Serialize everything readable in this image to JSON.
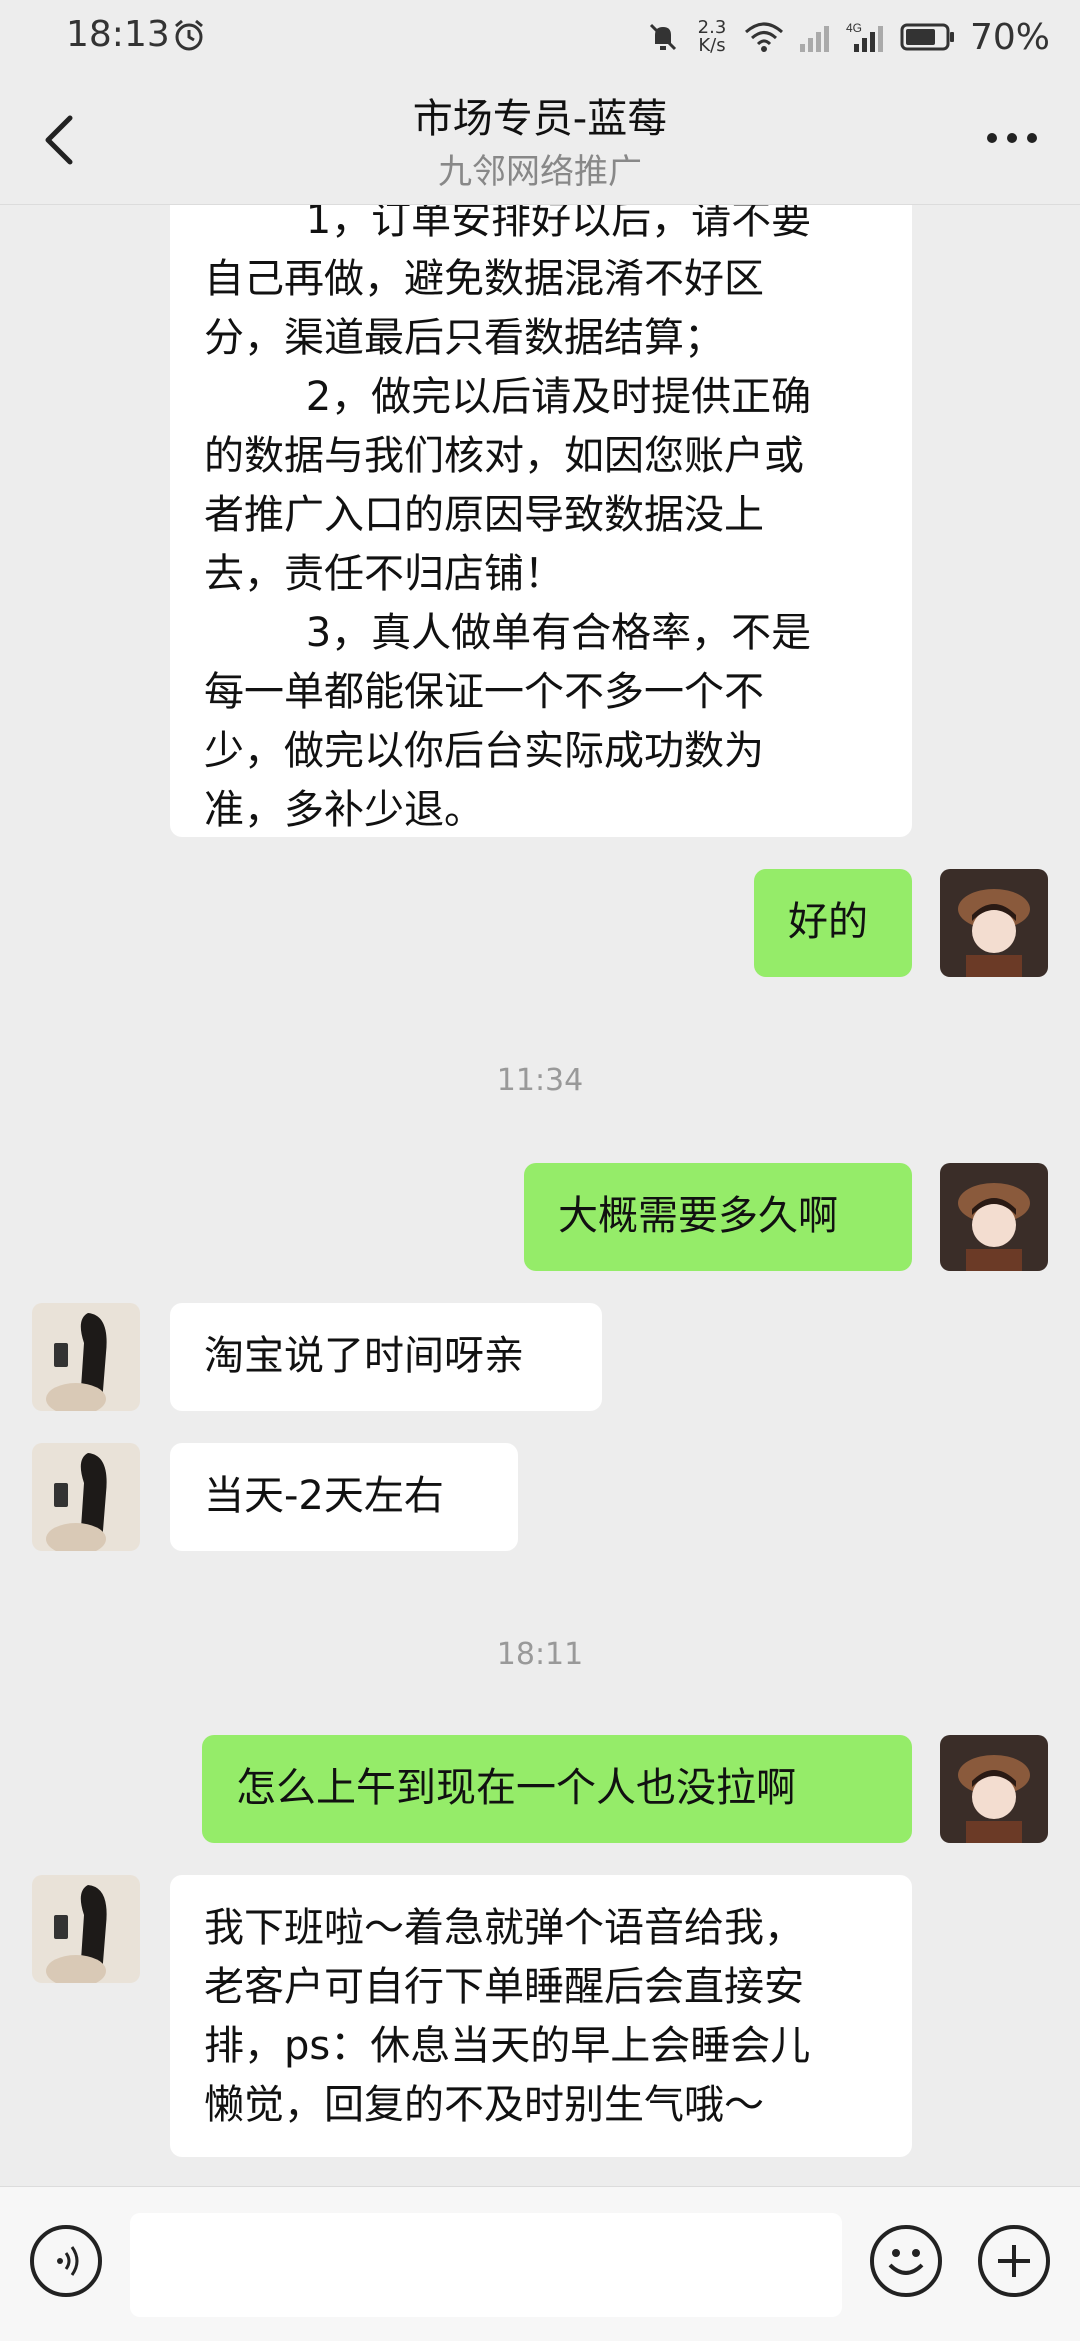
{
  "status_bar": {
    "time": "18:13",
    "net_speed_top": "2.3",
    "net_speed_bottom": "K/s",
    "battery": "70%"
  },
  "header": {
    "title": "市场专员-蓝莓",
    "subtitle": "九邻网络推广"
  },
  "messages": [
    {
      "side": "left",
      "text": "        1，订单安排好以后，请不要\n自己再做，避免数据混淆不好区\n分，渠道最后只看数据结算；\n        2，做完以后请及时提供正确\n的数据与我们核对，如因您账户或\n者推广入口的原因导致数据没上\n去，责任不归店铺！\n        3，真人做单有合格率，不是\n每一单都能保证一个不多一个不\n少，做完以你后台实际成功数为\n准，多补少退。"
    },
    {
      "side": "right",
      "text": "好的"
    },
    {
      "time": "11:34"
    },
    {
      "side": "right",
      "text": "大概需要多久啊"
    },
    {
      "side": "left",
      "text": "淘宝说了时间呀亲"
    },
    {
      "side": "left",
      "text": "当天-2天左右"
    },
    {
      "time": "18:11"
    },
    {
      "side": "right",
      "text": "怎么上午到现在一个人也没拉啊"
    },
    {
      "side": "left",
      "text": "我下班啦～着急就弹个语音给我，\n老客户可自行下单睡醒后会直接安\n排，ps：休息当天的早上会睡会儿\n懒觉，回复的不及时别生气哦～"
    }
  ],
  "colors": {
    "background": "#ededed",
    "bubble_self": "#95ec69",
    "bubble_other": "#ffffff"
  },
  "icons": {
    "back": "chevron-left-icon",
    "more": "more-dots-icon",
    "voice": "voice-icon",
    "emoji": "emoji-icon",
    "add": "plus-icon"
  }
}
